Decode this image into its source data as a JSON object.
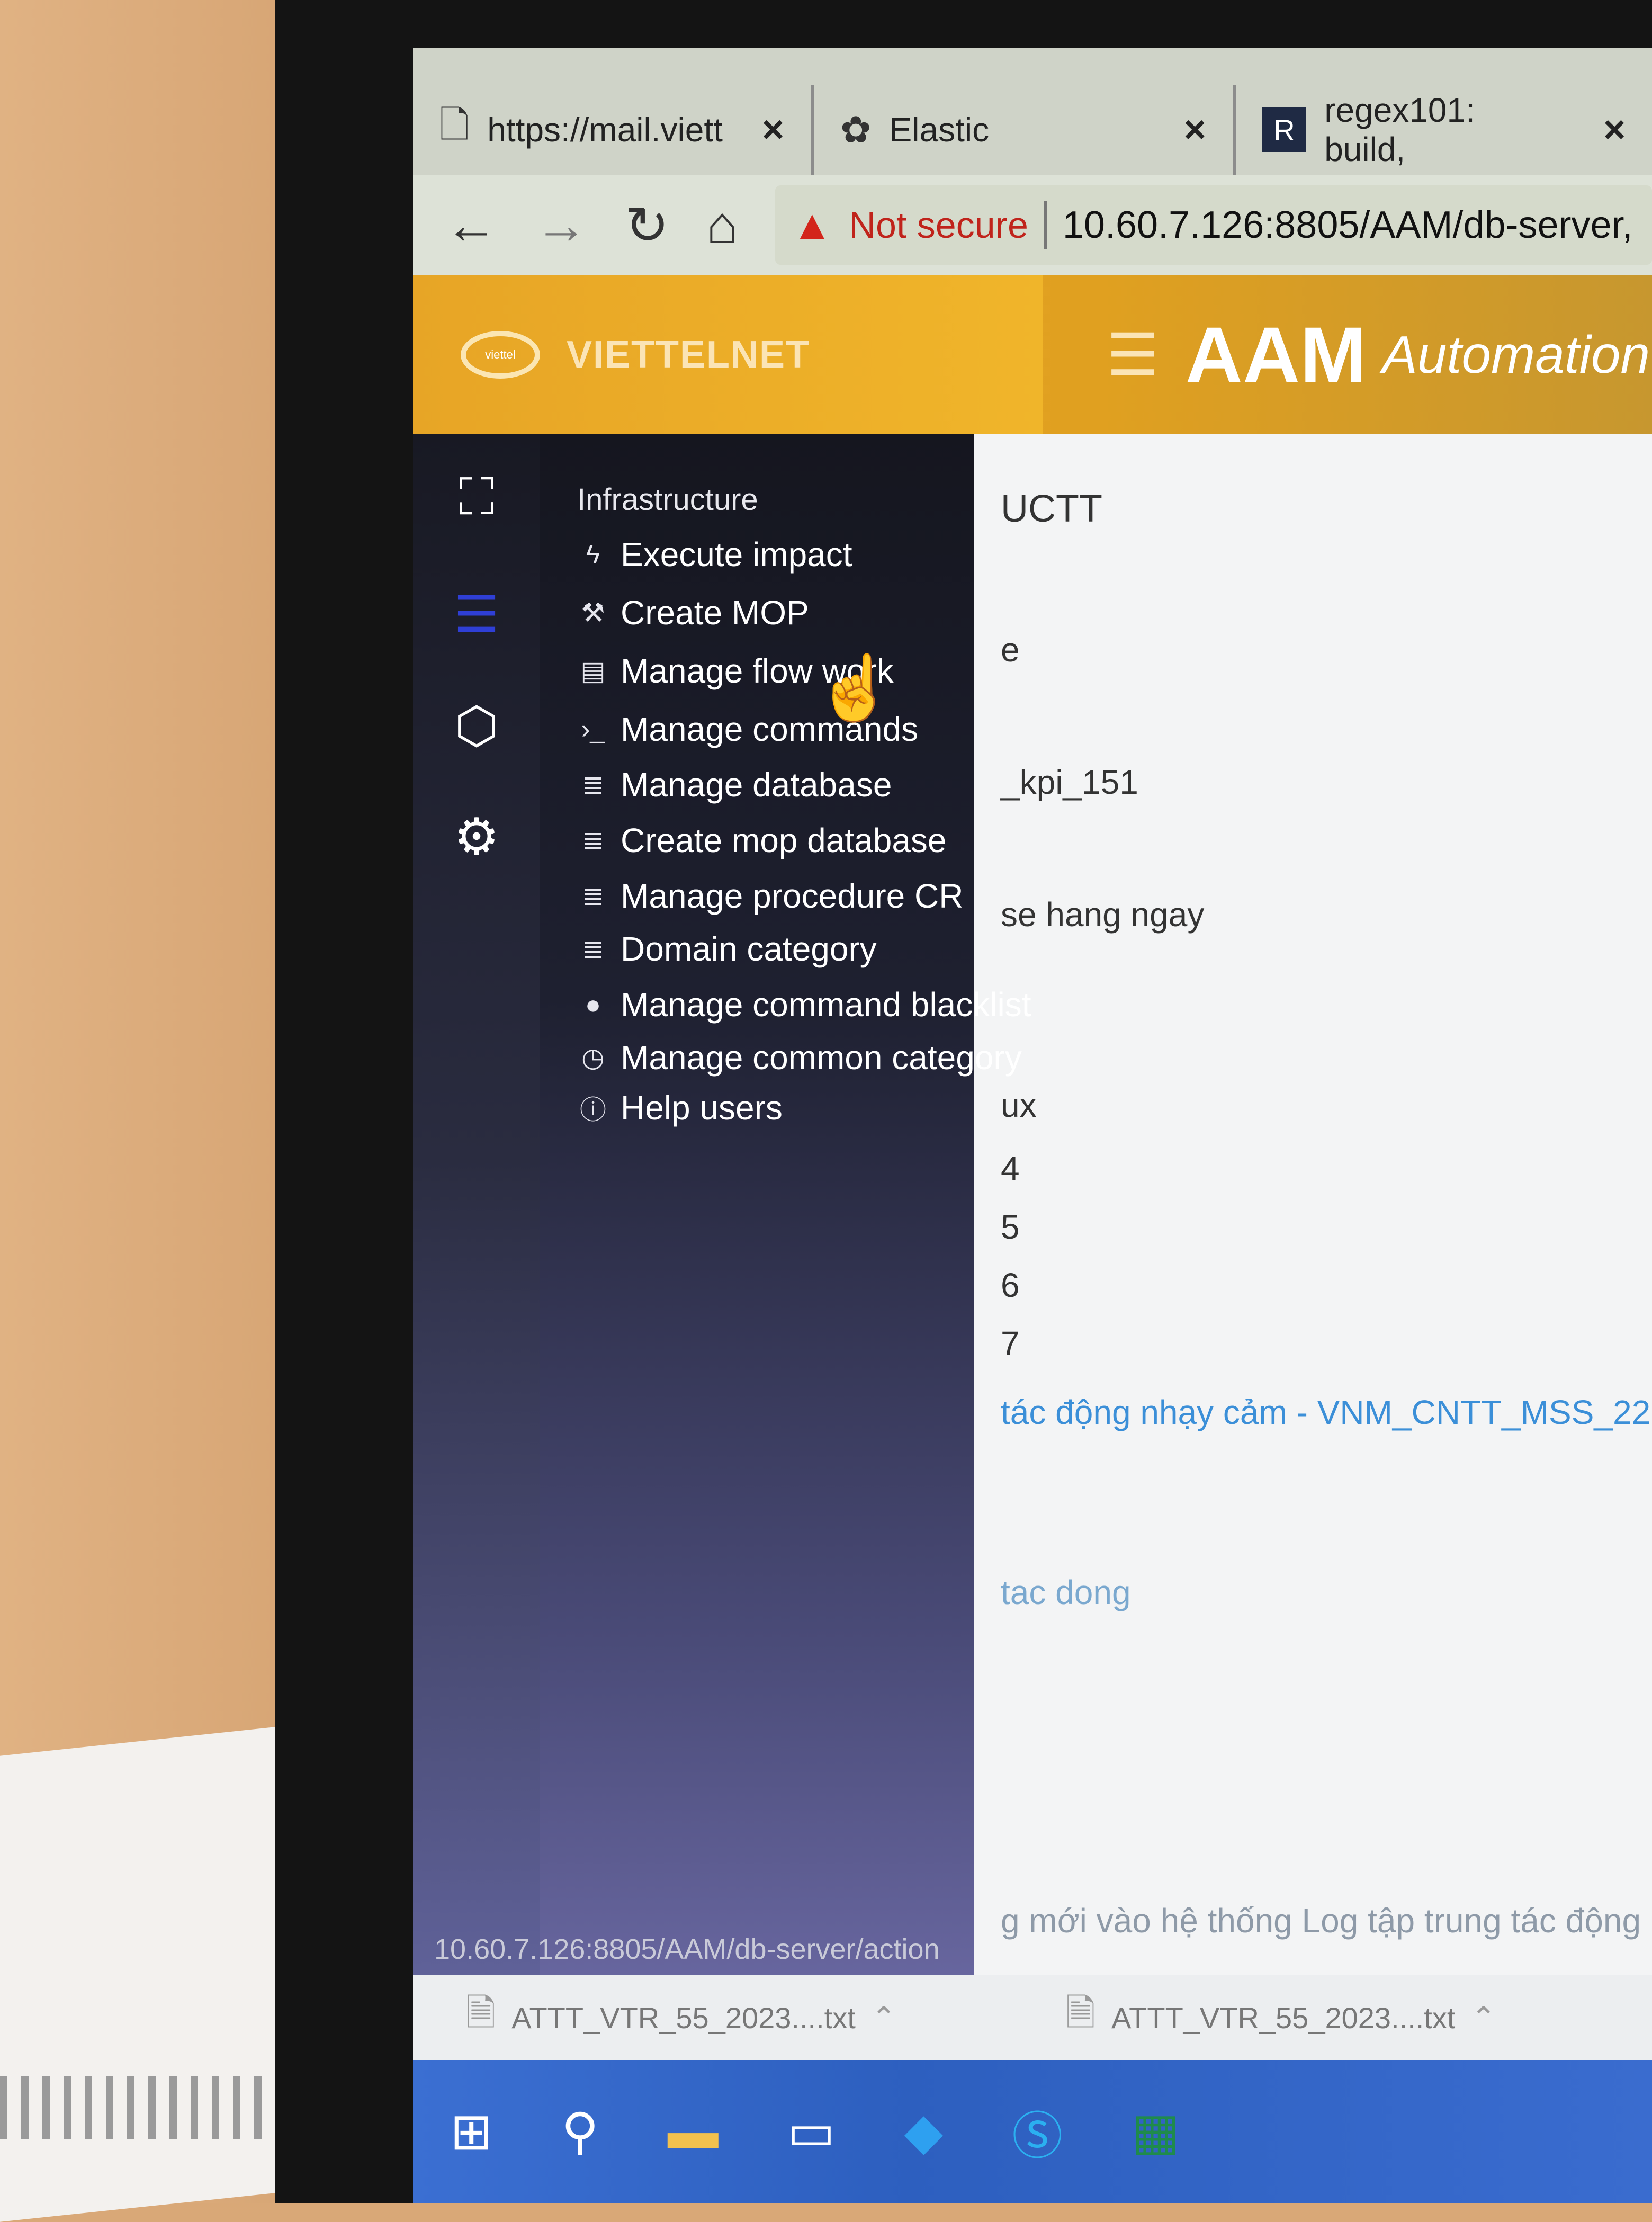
{
  "browser": {
    "tabs": [
      {
        "icon": "page-icon",
        "title": "https://mail.viett",
        "close": "×"
      },
      {
        "icon": "elastic-icon",
        "title": "Elastic",
        "close": "×"
      },
      {
        "icon": "regex-icon",
        "badge": "R",
        "title": "regex101: build,",
        "close": "×"
      }
    ],
    "security_label": "Not secure",
    "url": "10.60.7.126:8805/AAM/db-server,"
  },
  "header": {
    "brand": "VIETTELNET",
    "title": "AAM",
    "subtitle": "Automation"
  },
  "sidebar": {
    "heading": "Infrastructure",
    "items": [
      {
        "icon": "bolt-icon",
        "label": "Execute impact"
      },
      {
        "icon": "hammer-icon",
        "label": "Create MOP"
      },
      {
        "icon": "table-icon",
        "label": "Manage flow work"
      },
      {
        "icon": "terminal-icon",
        "label": "Manage commands"
      },
      {
        "icon": "database-icon",
        "label": "Manage database"
      },
      {
        "icon": "database-icon",
        "label": "Create mop database"
      },
      {
        "icon": "database-icon",
        "label": "Manage procedure CR"
      },
      {
        "icon": "database-icon",
        "label": "Domain category"
      },
      {
        "icon": "blacklist-icon",
        "label": "Manage command blacklist"
      },
      {
        "icon": "clock-icon",
        "label": "Manage common category"
      },
      {
        "icon": "info-icon",
        "label": "Help users"
      }
    ]
  },
  "content": {
    "lines": [
      "UCTT",
      "e",
      "_kpi_151",
      "se hang ngay",
      "ux",
      "4",
      "5",
      "6",
      "7",
      "tác động nhạy cảm - VNM_CNTT_MSS_22",
      "tac dong",
      "g mới vào hệ thống Log tập trung tác động"
    ]
  },
  "status_url": "10.60.7.126:8805/AAM/db-server/action",
  "downloads": [
    {
      "name": "ATTT_VTR_55_2023....txt"
    },
    {
      "name": "ATTT_VTR_55_2023....txt"
    }
  ],
  "colors": {
    "header": "#e9a829",
    "sidebar_active": "#2f3fd6",
    "link": "#3b8fd8"
  }
}
